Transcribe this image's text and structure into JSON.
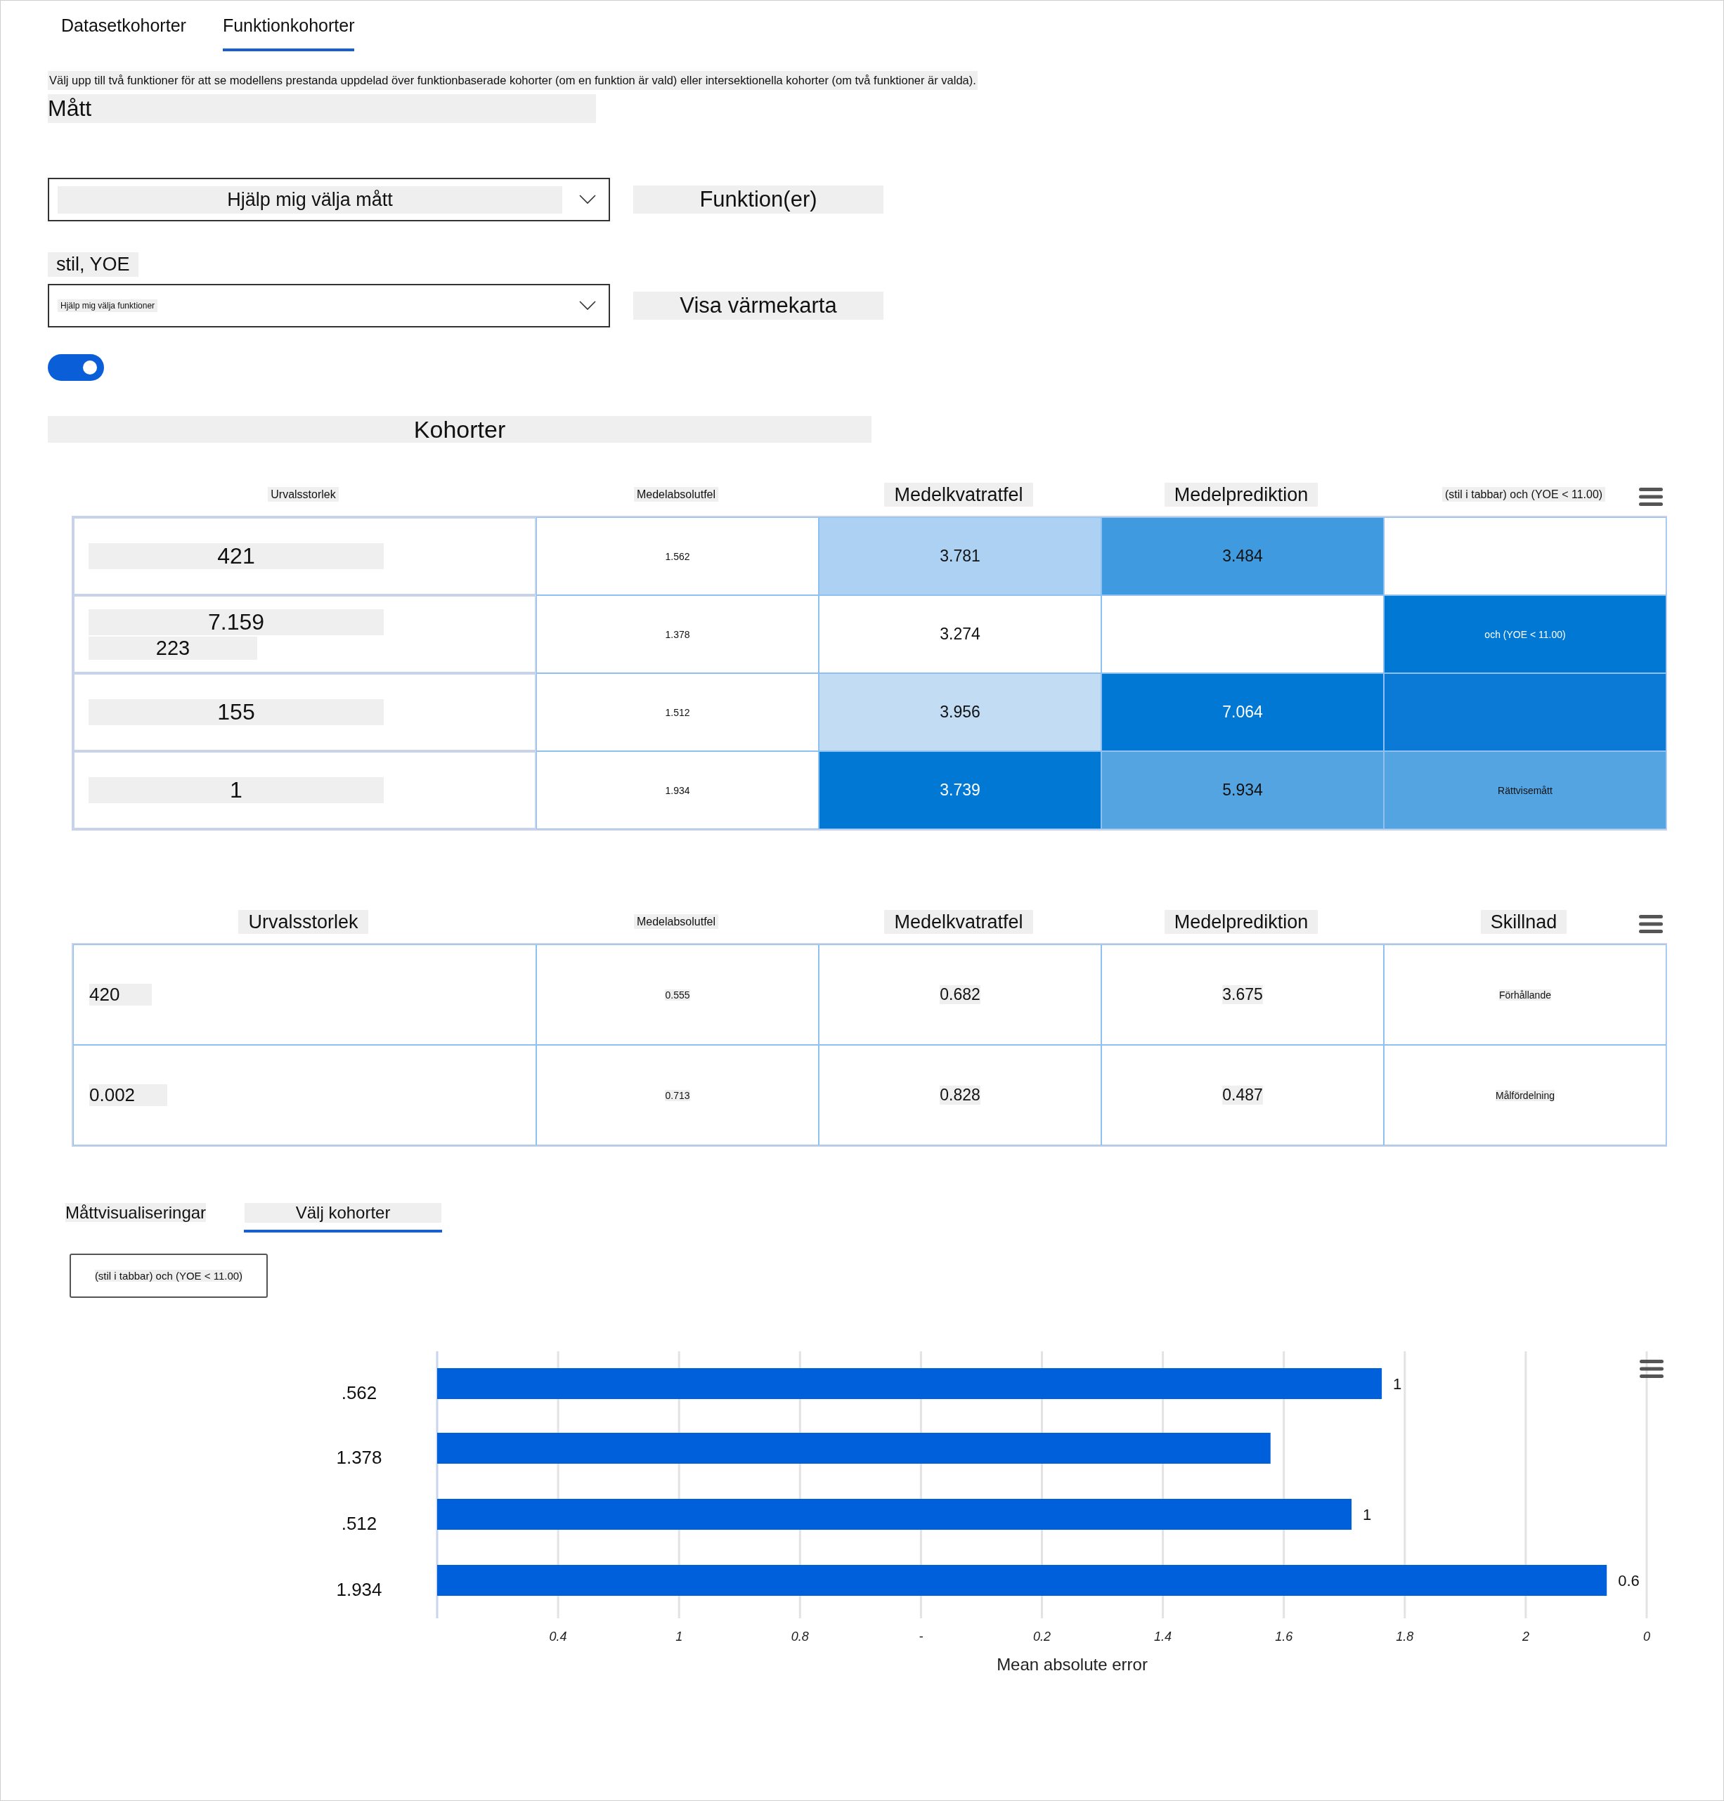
{
  "tabs": [
    {
      "label": "Datasetkohorter",
      "selected": false
    },
    {
      "label": "Funktionkohorter",
      "selected": true
    }
  ],
  "description": "Välj upp till två funktioner för att se modellens prestanda uppdelad över funktionbaserade kohorter (om en funktion är vald) eller intersektionella kohorter (om två funktioner är valda).",
  "metrics_label": "Mått",
  "metrics_dropdown": {
    "value": "Hjälp mig välja mått"
  },
  "features_label": "Funktion(er)",
  "features_selection": "stil, YOE",
  "features_dropdown": {
    "value": "Hjälp mig välja funktioner"
  },
  "heatmap_label": "Visa värmekarta",
  "heatmap_toggle": {
    "on": true
  },
  "cohorts_title": "Kohorter",
  "cohort_table": {
    "columns": [
      "Urvalsstorlek",
      "Medelabsolutfel",
      "Medelkvatratfel",
      "Medelprediktion",
      "(stil i tabbar) och (YOE < 11.00)"
    ],
    "rows": [
      {
        "cells": [
          {
            "lines": [
              "421"
            ]
          },
          {
            "text": "1.562"
          },
          {
            "text": "3.781",
            "color": "#acd1f2"
          },
          {
            "text": "3.484",
            "color": "#3f9ae0"
          },
          {
            "color": "#ffffff"
          }
        ]
      },
      {
        "cells": [
          {
            "lines": [
              "7.159",
              "223"
            ]
          },
          {
            "text": "1.378"
          },
          {
            "text": "3.274",
            "color": "#ffffff"
          },
          {
            "color": "#ffffff"
          },
          {
            "text": "och (YOE < 11.00)",
            "color": "#0078d4"
          }
        ]
      },
      {
        "cells": [
          {
            "lines": [
              "155"
            ]
          },
          {
            "text": "1.512"
          },
          {
            "text": "3.956",
            "color": "#c2ddf3"
          },
          {
            "text": "7.064",
            "color": "#0078d4"
          },
          {
            "color": "#0a7ad6"
          }
        ]
      },
      {
        "cells": [
          {
            "lines": [
              "1"
            ]
          },
          {
            "text": "1.934"
          },
          {
            "text": "3.739",
            "color": "#0078d4"
          },
          {
            "text": "5.934",
            "color": "#55a4e2"
          },
          {
            "text": "Rättvisemått",
            "color": "#55a4e2"
          }
        ]
      }
    ]
  },
  "summary_table": {
    "columns": [
      "Urvalsstorlek",
      "Medelabsolutfel",
      "Medelkvatratfel",
      "Medelprediktion",
      "Skillnad"
    ],
    "rows": [
      {
        "cells": [
          "420",
          "0.555",
          "0.682",
          "3.675",
          "Förhållande"
        ]
      },
      {
        "cells": [
          "0.002",
          "0.713",
          "0.828",
          "0.487",
          "Målfördelning"
        ]
      }
    ]
  },
  "bottom_tabs": [
    {
      "label": "Måttvisualiseringar",
      "selected": false
    },
    {
      "label": "Välj kohorter",
      "selected": true
    }
  ],
  "cohort_button": "(stil i tabbar) och (YOE < 11.00)",
  "chart": {
    "xlabel": "Mean absolute error",
    "bars": [
      {
        "label": ".562",
        "end_label": "1"
      },
      {
        "label": "1.378"
      },
      {
        "label": ".512",
        "end_label": "1"
      },
      {
        "label": "1.934",
        "end_label": "0.6"
      }
    ],
    "tick_labels": [
      "0.4",
      "1",
      "0.8",
      "-",
      "0.2",
      "1.4",
      "1.6",
      "1.8",
      "2",
      "0"
    ]
  }
}
